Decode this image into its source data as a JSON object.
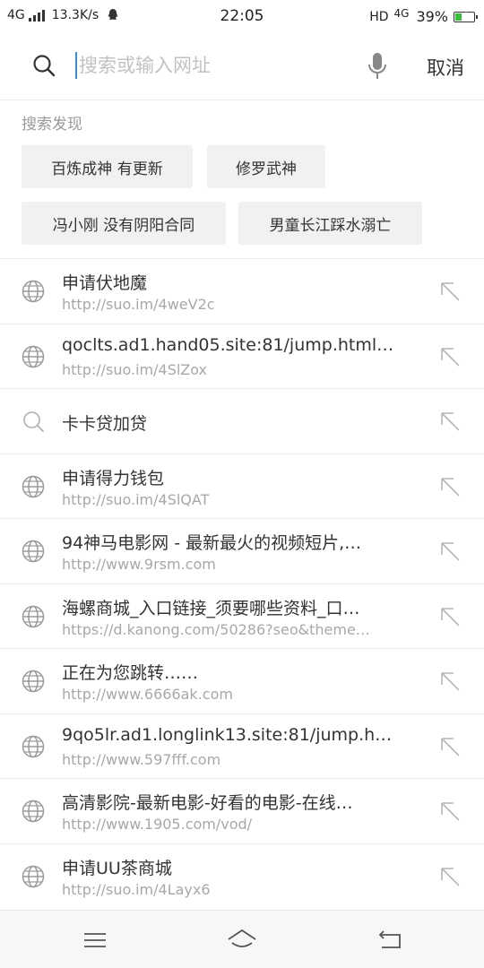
{
  "status": {
    "network": "4G",
    "speed": "13.3K/s",
    "time": "22:05",
    "hd": "HD",
    "network_right": "4G",
    "battery": "39%",
    "battery_level": 0.39,
    "battery_color": "#36c03a"
  },
  "search": {
    "placeholder": "搜索或输入网址",
    "cancel_label": "取消"
  },
  "discover": {
    "title": "搜索发现",
    "tags": [
      "百炼成神 有更新",
      "修罗武神",
      "冯小刚 没有阴阳合同",
      "男童长江踩水溺亡"
    ]
  },
  "items": [
    {
      "icon": "globe-icon",
      "title": "申请伏地魔",
      "url": "http://suo.im/4weV2c"
    },
    {
      "icon": "globe-icon",
      "title": "qoclts.ad1.hand05.site:81/jump.html…",
      "url": "http://suo.im/4SlZox"
    },
    {
      "icon": "search-icon",
      "title": "卡卡贷加贷",
      "url": ""
    },
    {
      "icon": "globe-icon",
      "title": "申请得力钱包",
      "url": "http://suo.im/4SlQAT"
    },
    {
      "icon": "globe-icon",
      "title": "94神马电影网 - 最新最火的视频短片,…",
      "url": "http://www.9rsm.com"
    },
    {
      "icon": "globe-icon",
      "title": "海螺商城_入口链接_须要哪些资料_口…",
      "url": "https://d.kanong.com/50286?seo&theme…"
    },
    {
      "icon": "globe-icon",
      "title": "正在为您跳转……",
      "url": "http://www.6666ak.com"
    },
    {
      "icon": "globe-icon",
      "title": "9qo5lr.ad1.longlink13.site:81/jump.h…",
      "url": "http://www.597fff.com"
    },
    {
      "icon": "globe-icon",
      "title": "高清影院-最新电影-好看的电影-在线…",
      "url": "http://www.1905.com/vod/"
    },
    {
      "icon": "globe-icon",
      "title": "申请UU茶商城",
      "url": "http://suo.im/4Layx6"
    }
  ]
}
